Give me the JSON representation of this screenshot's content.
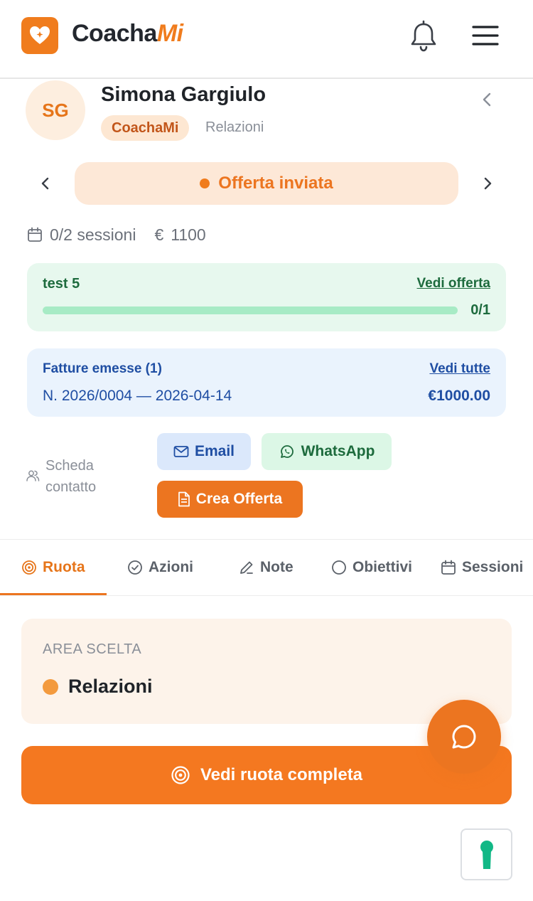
{
  "header": {
    "brand_part1": "Coacha",
    "brand_part2": "Mi",
    "logo_icon": "heart-icon",
    "notification_icon": "bell-icon",
    "menu_icon": "hamburger-menu-icon"
  },
  "profile": {
    "initials": "SG",
    "name": "Simona Gargiulo",
    "tag": "CoachaMi",
    "area": "Relazioni"
  },
  "status": {
    "label": "Offerta inviata",
    "color": "#f07c1d"
  },
  "meta": {
    "sessions": "0/2 sessioni",
    "currency": "€",
    "amount": "1100"
  },
  "offer": {
    "title": "test 5",
    "link": "Vedi offerta",
    "count": "0/1",
    "progress": 0
  },
  "invoices": {
    "title": "Fatture emesse (1)",
    "link": "Vedi tutte",
    "line": "N. 2026/0004 — 2026-04-14",
    "amount": "€1000.00"
  },
  "contact": {
    "sheet_label": "Scheda contatto",
    "email_label": "Email",
    "whatsapp_label": "WhatsApp",
    "create_offer_label": "Crea Offerta"
  },
  "tabs": [
    {
      "label": "Ruota",
      "icon": "target-icon",
      "active": true
    },
    {
      "label": "Azioni",
      "icon": "check-circle-icon",
      "active": false
    },
    {
      "label": "Note",
      "icon": "pencil-icon",
      "active": false
    },
    {
      "label": "Obiettivi",
      "icon": "circle-icon",
      "active": false
    },
    {
      "label": "Sessioni",
      "icon": "calendar-icon",
      "active": false
    }
  ],
  "area_card": {
    "label": "AREA SCELTA",
    "value": "Relazioni"
  },
  "wheel_button": {
    "label": "Vedi ruota completa"
  },
  "colors": {
    "brand": "#f07c1d",
    "green": "#1d6b3d",
    "blue": "#1f4ea3"
  }
}
